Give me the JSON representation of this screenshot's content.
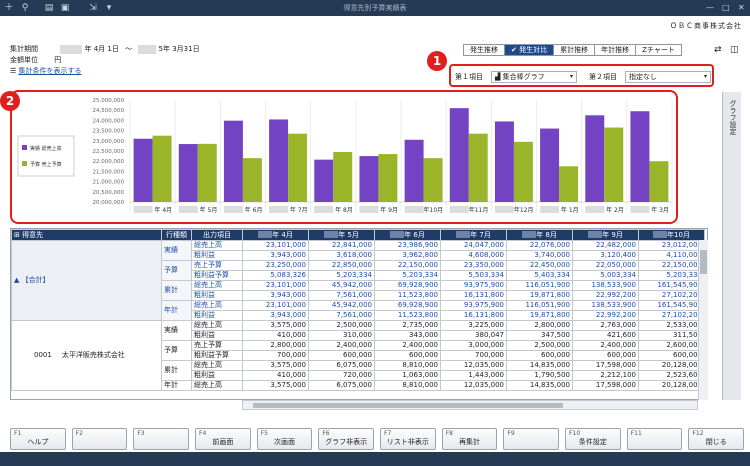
{
  "titlebar": {
    "title": "得意先別予算実績表",
    "icons": [
      "add-icon",
      "zoom-icon",
      "print-icon",
      "preview-icon",
      "export-icon",
      "dropdown-icon"
    ],
    "controls": [
      "—",
      "□",
      "✕"
    ]
  },
  "company": "ＯＢＣ商事株式会社",
  "header": {
    "period_label": "集計期間",
    "period_start": "年 4月 1日",
    "period_sep": "〜",
    "period_end": "5年 3月31日",
    "unit_label": "金額単位",
    "unit_value": "円",
    "show_conditions": "集計条件を表示する"
  },
  "tabs": [
    "発生推移",
    "✔ 発生対比",
    "累計推移",
    "年計推移",
    "Zチャート"
  ],
  "tab_active_index": 1,
  "selectors": {
    "item1_label": "第１項目",
    "item1_value": "集合棒グラフ",
    "item2_label": "第２項目",
    "item2_value": "指定なし"
  },
  "badges": {
    "b1": "1",
    "b2": "2"
  },
  "side_panel_label": "グラフ設定",
  "chart_data": {
    "type": "bar",
    "categories": [
      "年 4月",
      "年 5月",
      "年 6月",
      "年 7月",
      "年 8月",
      "年 9月",
      "年10月",
      "年11月",
      "年12月",
      "年 1月",
      "年 2月",
      "年 3月"
    ],
    "series": [
      {
        "name": "実績  総売上高",
        "color": "#7343c4",
        "values": [
          23101000,
          22841000,
          23987000,
          24047000,
          22076000,
          22250000,
          23050000,
          24600000,
          23950000,
          23600000,
          24250000,
          24450000
        ]
      },
      {
        "name": "予算  売上予算",
        "color": "#9ab52a",
        "values": [
          23250000,
          22850000,
          22150000,
          23350000,
          22450000,
          22350000,
          22150000,
          23350000,
          22950000,
          21750000,
          23650000,
          22000000
        ]
      }
    ],
    "yticks": [
      "25,000,000",
      "24,500,000",
      "24,000,000",
      "23,500,000",
      "23,000,000",
      "22,500,000",
      "22,000,000",
      "21,500,000",
      "21,000,000",
      "20,500,000",
      "20,000,000"
    ],
    "ylim": [
      20000000,
      25000000
    ]
  },
  "table": {
    "headers": {
      "customer": "得意先",
      "row_type": "行種類",
      "output_item": "出力項目",
      "months": [
        "年 4月",
        "年 5月",
        "年 6月",
        "年 7月",
        "年 8月",
        "年 9月",
        "年10月"
      ]
    },
    "group1": {
      "label": "▲ 【合計】",
      "rows": [
        {
          "type": "実績",
          "item": "総売上高",
          "values": [
            "23,101,000",
            "22,841,000",
            "23,986,900",
            "24,047,000",
            "22,076,000",
            "22,482,000",
            "23,012,000"
          ]
        },
        {
          "type": "",
          "item": "粗利益",
          "values": [
            "3,943,000",
            "3,618,000",
            "3,962,800",
            "4,608,000",
            "3,740,000",
            "3,120,400",
            "4,110,000"
          ]
        },
        {
          "type": "予算",
          "item": "売上予算",
          "values": [
            "23,250,000",
            "22,850,000",
            "22,150,000",
            "23,350,000",
            "22,450,000",
            "22,050,000",
            "22,150,000"
          ]
        },
        {
          "type": "",
          "item": "粗利益予算",
          "values": [
            "5,083,326",
            "5,203,334",
            "5,203,334",
            "5,503,334",
            "5,403,334",
            "5,003,334",
            "5,203,334"
          ]
        },
        {
          "type": "累計",
          "item": "総売上高",
          "values": [
            "23,101,000",
            "45,942,000",
            "69,928,900",
            "93,975,900",
            "116,051,900",
            "138,533,900",
            "161,545,900"
          ]
        },
        {
          "type": "",
          "item": "粗利益",
          "values": [
            "3,943,000",
            "7,561,000",
            "11,523,800",
            "16,131,800",
            "19,871,800",
            "22,992,200",
            "27,102,200"
          ]
        },
        {
          "type": "年計",
          "item": "総売上高",
          "values": [
            "23,101,000",
            "45,942,000",
            "69,928,900",
            "93,975,900",
            "116,051,900",
            "138,533,900",
            "161,545,900"
          ]
        },
        {
          "type": "",
          "item": "粗利益",
          "values": [
            "3,943,000",
            "7,561,000",
            "11,523,800",
            "16,131,800",
            "19,871,800",
            "22,992,200",
            "27,102,200"
          ]
        }
      ]
    },
    "group2": {
      "code": "0001",
      "name": "太平洋販売株式会社",
      "rows": [
        {
          "type": "実績",
          "item": "総売上高",
          "values": [
            "3,575,000",
            "2,500,000",
            "2,735,000",
            "3,225,000",
            "2,800,000",
            "2,763,000",
            "2,533,000"
          ]
        },
        {
          "type": "",
          "item": "粗利益",
          "values": [
            "410,000",
            "310,000",
            "343,000",
            "380,047",
            "347,500",
            "421,600",
            "311,500"
          ]
        },
        {
          "type": "予算",
          "item": "売上予算",
          "values": [
            "2,800,000",
            "2,400,000",
            "2,400,000",
            "3,000,000",
            "2,500,000",
            "2,400,000",
            "2,600,000"
          ]
        },
        {
          "type": "",
          "item": "粗利益予算",
          "values": [
            "700,000",
            "600,000",
            "600,000",
            "700,000",
            "600,000",
            "600,000",
            "600,000"
          ]
        },
        {
          "type": "累計",
          "item": "総売上高",
          "values": [
            "3,575,000",
            "6,075,000",
            "8,810,000",
            "12,035,000",
            "14,835,000",
            "17,598,000",
            "20,128,000"
          ]
        },
        {
          "type": "",
          "item": "粗利益",
          "values": [
            "410,000",
            "720,000",
            "1,063,000",
            "1,443,000",
            "1,790,500",
            "2,212,100",
            "2,523,600"
          ]
        },
        {
          "type": "年計",
          "item": "総売上高",
          "values": [
            "3,575,000",
            "6,075,000",
            "8,810,000",
            "12,035,000",
            "14,835,000",
            "17,598,000",
            "20,128,000"
          ]
        }
      ]
    }
  },
  "fkeys": [
    {
      "key": "F1",
      "label": "ヘルプ"
    },
    {
      "key": "F2",
      "label": ""
    },
    {
      "key": "F3",
      "label": ""
    },
    {
      "key": "F4",
      "label": "前画面"
    },
    {
      "key": "F5",
      "label": "次画面"
    },
    {
      "key": "F6",
      "label": "グラフ非表示"
    },
    {
      "key": "F7",
      "label": "リスト非表示"
    },
    {
      "key": "F8",
      "label": "再集計"
    },
    {
      "key": "F9",
      "label": ""
    },
    {
      "key": "F10",
      "label": "条件設定"
    },
    {
      "key": "F11",
      "label": ""
    },
    {
      "key": "F12",
      "label": "閉じる"
    }
  ]
}
